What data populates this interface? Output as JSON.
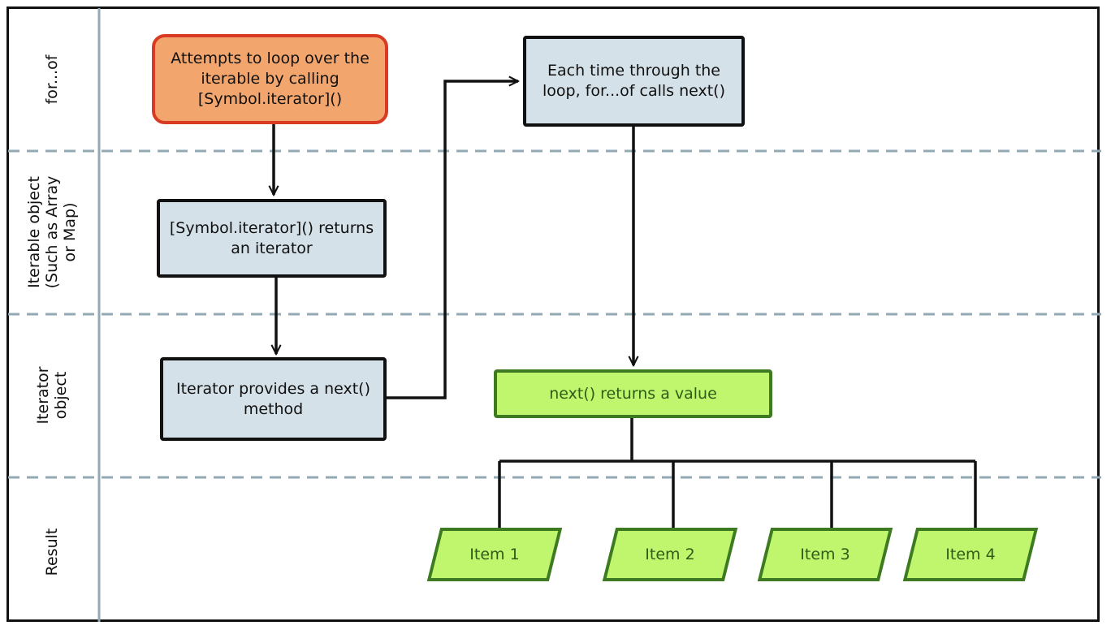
{
  "lanes": [
    {
      "label": "for...of"
    },
    {
      "label": "Iterable object (Such as Array or Map)",
      "line1": "Iterable object",
      "line2": "(Such as Array",
      "line3": "or Map)"
    },
    {
      "label": "Iterator object",
      "line1": "Iterator",
      "line2": "object"
    },
    {
      "label": "Result"
    }
  ],
  "nodes": {
    "attempt": "Attempts to loop over the iterable by calling [Symbol.iterator]()",
    "returns_iterator": "[Symbol.iterator]() returns an iterator",
    "provides_next": "Iterator provides a next() method",
    "each_time": "Each time through the loop, for...of calls next()",
    "next_returns": "next() returns a value"
  },
  "items": [
    "Item 1",
    "Item 2",
    "Item 3",
    "Item 4"
  ],
  "colors": {
    "start_fill": "#f2a66d",
    "start_border": "#d83a24",
    "process_fill": "#d5e1e8",
    "result_fill": "#c0f56e",
    "result_border": "#3d7a22",
    "lane_divider": "#93aab5"
  }
}
